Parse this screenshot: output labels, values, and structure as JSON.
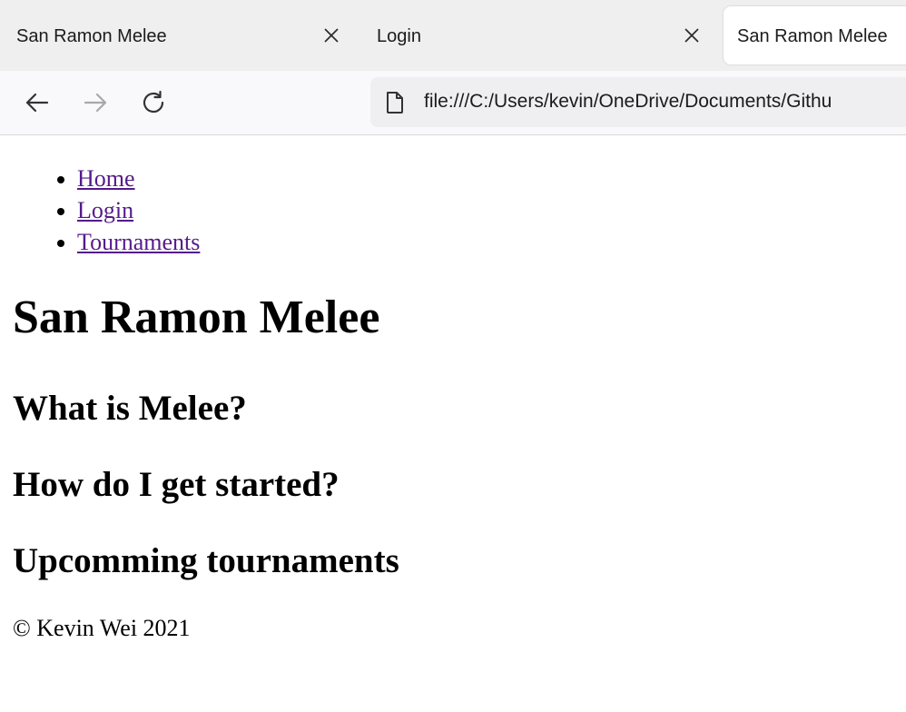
{
  "tabs": [
    {
      "title": "San Ramon Melee",
      "icons": {
        "close": "close-icon"
      }
    },
    {
      "title": "Login",
      "icons": {
        "close": "close-icon"
      }
    },
    {
      "title": "San Ramon Melee",
      "active": true
    }
  ],
  "toolbar": {
    "back_icon": "arrow-left-icon",
    "forward_icon": "arrow-right-icon",
    "reload_icon": "reload-icon",
    "url": "file:///C:/Users/kevin/OneDrive/Documents/Githu",
    "page_icon": "page-icon"
  },
  "nav": {
    "items": [
      "Home",
      "Login",
      "Tournaments"
    ]
  },
  "main": {
    "title": "San Ramon Melee",
    "sections": [
      "What is Melee?",
      "How do I get started?",
      "Upcomming tournaments"
    ]
  },
  "footer": {
    "text": "© Kevin Wei 2021"
  },
  "colors": {
    "link_visited": "#551a8b",
    "tabstrip_bg": "#efefef",
    "toolbar_bg": "#f9f9fb",
    "urlbar_bg": "#efeff1"
  }
}
